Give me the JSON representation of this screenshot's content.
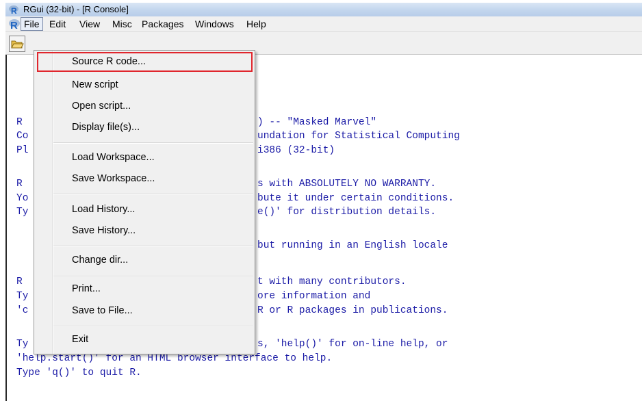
{
  "window": {
    "title": "RGui (32-bit) - [R Console]"
  },
  "menubar": {
    "items": [
      {
        "label": "File"
      },
      {
        "label": "Edit"
      },
      {
        "label": "View"
      },
      {
        "label": "Misc"
      },
      {
        "label": "Packages"
      },
      {
        "label": "Windows"
      },
      {
        "label": "Help"
      }
    ],
    "active": "File"
  },
  "file_menu": {
    "items": [
      {
        "label": "Source R code..."
      },
      {
        "label": "New script"
      },
      {
        "label": "Open script..."
      },
      {
        "label": "Display file(s)..."
      },
      {
        "label": "Load Workspace..."
      },
      {
        "label": "Save Workspace..."
      },
      {
        "label": "Load History..."
      },
      {
        "label": "Save History..."
      },
      {
        "label": "Change dir..."
      },
      {
        "label": "Print..."
      },
      {
        "label": "Save to File..."
      },
      {
        "label": "Exit"
      }
    ],
    "highlighted": "Source R code..."
  },
  "console": {
    "lines": [
      "R",
      "Co",
      "Pl",
      "R",
      "Yo",
      "Ty",
      "R",
      "Ty",
      "'c",
      "Ty",
      "'help.start()' for an HTML browser interface to help.",
      "Type 'q()' to quit R.",
      ") -- \"Masked Marvel\"",
      "undation for Statistical Computing",
      "i386 (32-bit)",
      "s with ABSOLUTELY NO WARRANTY.",
      "bute it under certain conditions.",
      "e()' for distribution details.",
      "but running in an English locale",
      "t with many contributors.",
      "ore information and",
      "R or R packages in publications.",
      "s, 'help()' for on-line help, or"
    ]
  },
  "colors": {
    "console_text": "#1a1aa6",
    "highlight_border": "#e0262d",
    "r_logo": "#2166c2"
  },
  "icons": [
    "r-logo-icon",
    "open-folder-icon"
  ]
}
